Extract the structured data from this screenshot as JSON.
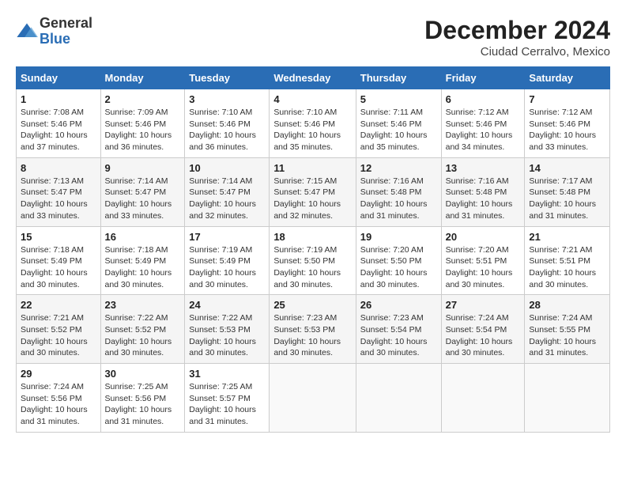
{
  "logo": {
    "general": "General",
    "blue": "Blue"
  },
  "header": {
    "title": "December 2024",
    "subtitle": "Ciudad Cerralvo, Mexico"
  },
  "weekdays": [
    "Sunday",
    "Monday",
    "Tuesday",
    "Wednesday",
    "Thursday",
    "Friday",
    "Saturday"
  ],
  "weeks": [
    [
      {
        "day": "1",
        "info": "Sunrise: 7:08 AM\nSunset: 5:46 PM\nDaylight: 10 hours and 37 minutes."
      },
      {
        "day": "2",
        "info": "Sunrise: 7:09 AM\nSunset: 5:46 PM\nDaylight: 10 hours and 36 minutes."
      },
      {
        "day": "3",
        "info": "Sunrise: 7:10 AM\nSunset: 5:46 PM\nDaylight: 10 hours and 36 minutes."
      },
      {
        "day": "4",
        "info": "Sunrise: 7:10 AM\nSunset: 5:46 PM\nDaylight: 10 hours and 35 minutes."
      },
      {
        "day": "5",
        "info": "Sunrise: 7:11 AM\nSunset: 5:46 PM\nDaylight: 10 hours and 35 minutes."
      },
      {
        "day": "6",
        "info": "Sunrise: 7:12 AM\nSunset: 5:46 PM\nDaylight: 10 hours and 34 minutes."
      },
      {
        "day": "7",
        "info": "Sunrise: 7:12 AM\nSunset: 5:46 PM\nDaylight: 10 hours and 33 minutes."
      }
    ],
    [
      {
        "day": "8",
        "info": "Sunrise: 7:13 AM\nSunset: 5:47 PM\nDaylight: 10 hours and 33 minutes."
      },
      {
        "day": "9",
        "info": "Sunrise: 7:14 AM\nSunset: 5:47 PM\nDaylight: 10 hours and 33 minutes."
      },
      {
        "day": "10",
        "info": "Sunrise: 7:14 AM\nSunset: 5:47 PM\nDaylight: 10 hours and 32 minutes."
      },
      {
        "day": "11",
        "info": "Sunrise: 7:15 AM\nSunset: 5:47 PM\nDaylight: 10 hours and 32 minutes."
      },
      {
        "day": "12",
        "info": "Sunrise: 7:16 AM\nSunset: 5:48 PM\nDaylight: 10 hours and 31 minutes."
      },
      {
        "day": "13",
        "info": "Sunrise: 7:16 AM\nSunset: 5:48 PM\nDaylight: 10 hours and 31 minutes."
      },
      {
        "day": "14",
        "info": "Sunrise: 7:17 AM\nSunset: 5:48 PM\nDaylight: 10 hours and 31 minutes."
      }
    ],
    [
      {
        "day": "15",
        "info": "Sunrise: 7:18 AM\nSunset: 5:49 PM\nDaylight: 10 hours and 30 minutes."
      },
      {
        "day": "16",
        "info": "Sunrise: 7:18 AM\nSunset: 5:49 PM\nDaylight: 10 hours and 30 minutes."
      },
      {
        "day": "17",
        "info": "Sunrise: 7:19 AM\nSunset: 5:49 PM\nDaylight: 10 hours and 30 minutes."
      },
      {
        "day": "18",
        "info": "Sunrise: 7:19 AM\nSunset: 5:50 PM\nDaylight: 10 hours and 30 minutes."
      },
      {
        "day": "19",
        "info": "Sunrise: 7:20 AM\nSunset: 5:50 PM\nDaylight: 10 hours and 30 minutes."
      },
      {
        "day": "20",
        "info": "Sunrise: 7:20 AM\nSunset: 5:51 PM\nDaylight: 10 hours and 30 minutes."
      },
      {
        "day": "21",
        "info": "Sunrise: 7:21 AM\nSunset: 5:51 PM\nDaylight: 10 hours and 30 minutes."
      }
    ],
    [
      {
        "day": "22",
        "info": "Sunrise: 7:21 AM\nSunset: 5:52 PM\nDaylight: 10 hours and 30 minutes."
      },
      {
        "day": "23",
        "info": "Sunrise: 7:22 AM\nSunset: 5:52 PM\nDaylight: 10 hours and 30 minutes."
      },
      {
        "day": "24",
        "info": "Sunrise: 7:22 AM\nSunset: 5:53 PM\nDaylight: 10 hours and 30 minutes."
      },
      {
        "day": "25",
        "info": "Sunrise: 7:23 AM\nSunset: 5:53 PM\nDaylight: 10 hours and 30 minutes."
      },
      {
        "day": "26",
        "info": "Sunrise: 7:23 AM\nSunset: 5:54 PM\nDaylight: 10 hours and 30 minutes."
      },
      {
        "day": "27",
        "info": "Sunrise: 7:24 AM\nSunset: 5:54 PM\nDaylight: 10 hours and 30 minutes."
      },
      {
        "day": "28",
        "info": "Sunrise: 7:24 AM\nSunset: 5:55 PM\nDaylight: 10 hours and 31 minutes."
      }
    ],
    [
      {
        "day": "29",
        "info": "Sunrise: 7:24 AM\nSunset: 5:56 PM\nDaylight: 10 hours and 31 minutes."
      },
      {
        "day": "30",
        "info": "Sunrise: 7:25 AM\nSunset: 5:56 PM\nDaylight: 10 hours and 31 minutes."
      },
      {
        "day": "31",
        "info": "Sunrise: 7:25 AM\nSunset: 5:57 PM\nDaylight: 10 hours and 31 minutes."
      },
      {
        "day": "",
        "info": ""
      },
      {
        "day": "",
        "info": ""
      },
      {
        "day": "",
        "info": ""
      },
      {
        "day": "",
        "info": ""
      }
    ]
  ]
}
